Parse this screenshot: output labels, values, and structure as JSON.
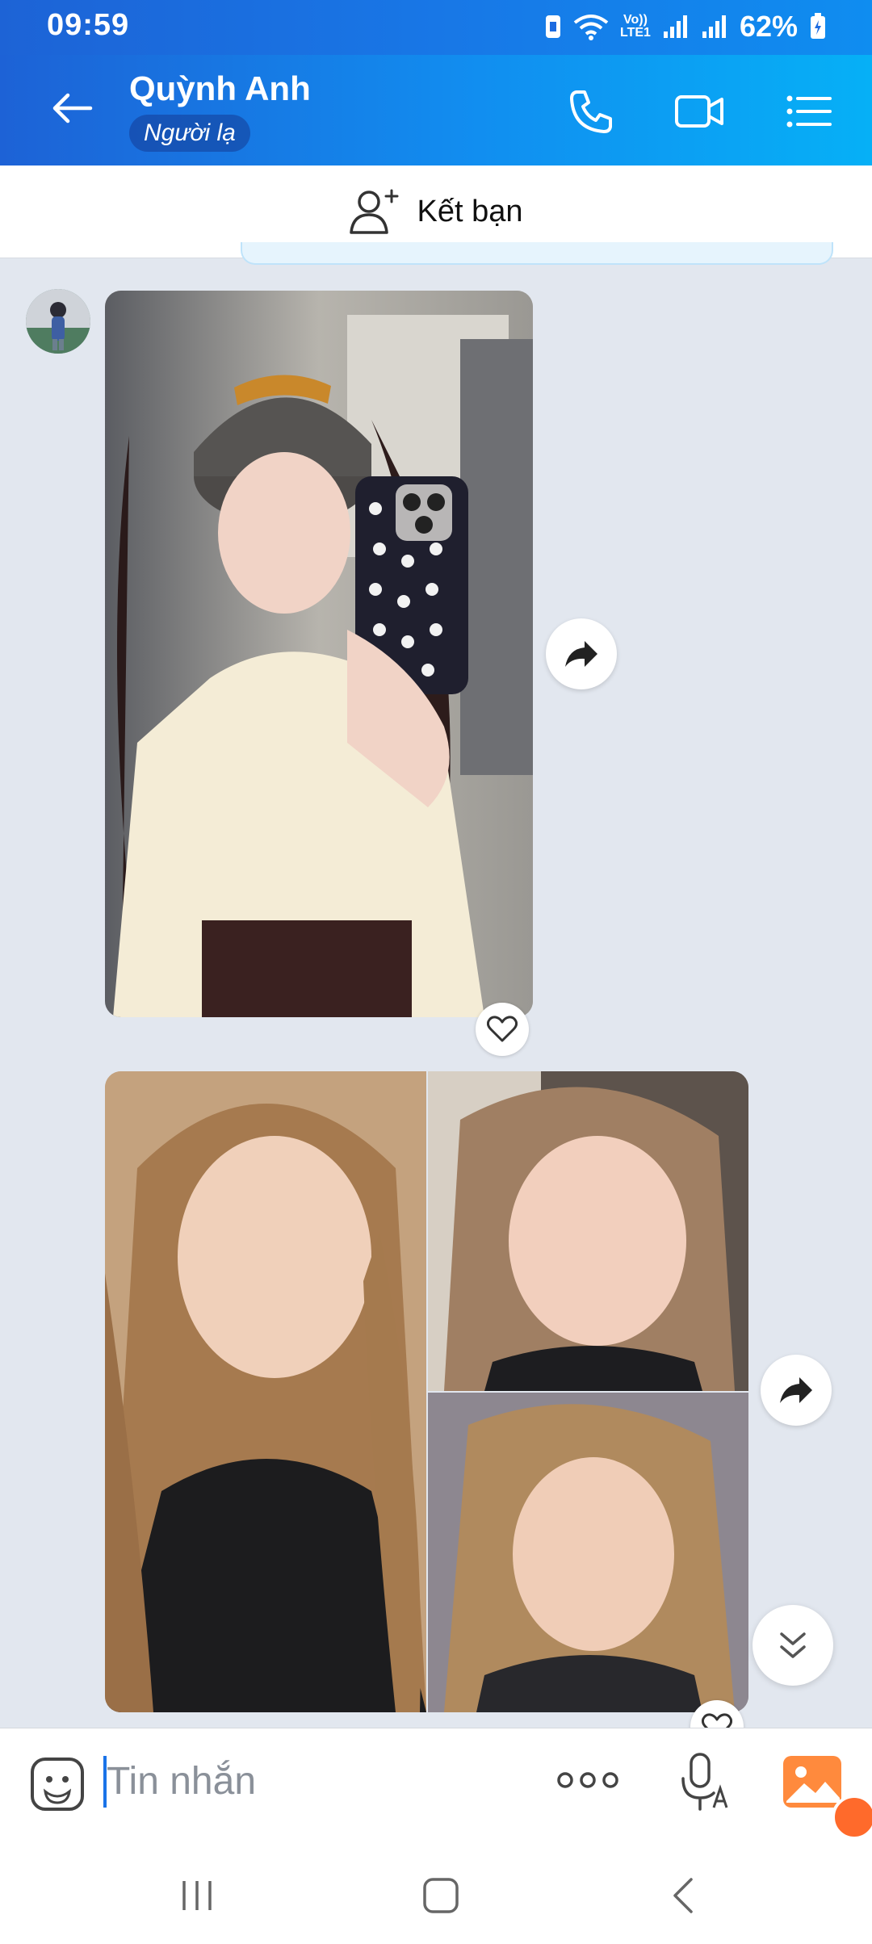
{
  "status_bar": {
    "time": "09:59",
    "net_top": "Vo))",
    "net_bottom": "LTE1",
    "battery": "62%"
  },
  "header": {
    "title": "Quỳnh Anh",
    "badge": "Người lạ"
  },
  "friend_bar": {
    "label": "Kết bạn"
  },
  "composer": {
    "placeholder": "Tin nhắn"
  },
  "colors": {
    "header_gradient_start": "#1d62d6",
    "header_gradient_end": "#06b0f6",
    "chat_background": "#e2e7ef",
    "accent": "#1a73e8",
    "gallery_orange": "#ff8a3d"
  },
  "icons": [
    "back-arrow-icon",
    "phone-icon",
    "video-call-icon",
    "menu-list-icon",
    "add-user-icon",
    "share-icon",
    "heart-icon",
    "scroll-down-icon",
    "sticker-icon",
    "more-icon",
    "voice-text-icon",
    "gallery-icon"
  ]
}
